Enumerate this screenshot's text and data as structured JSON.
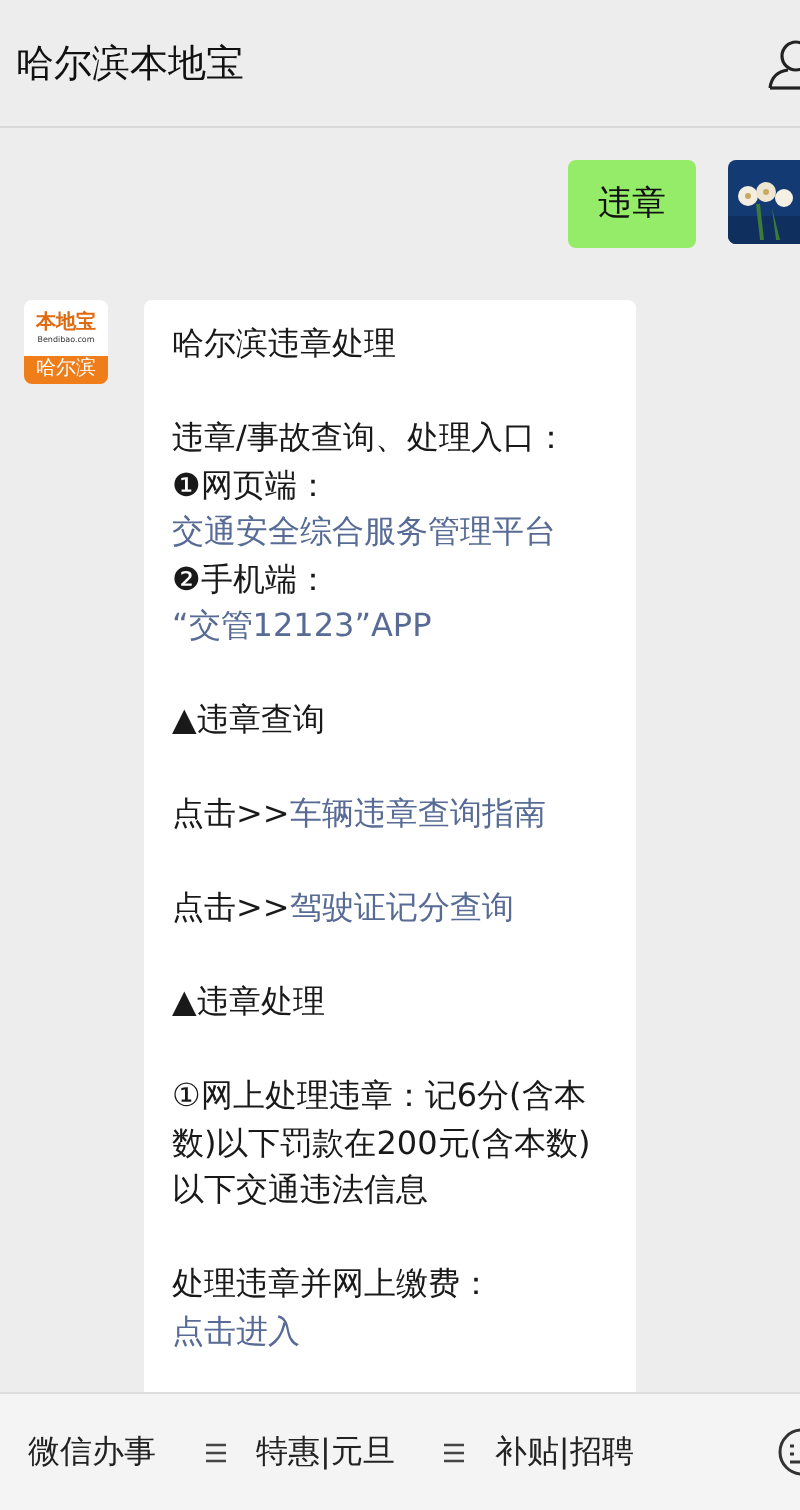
{
  "header": {
    "title": "哈尔滨本地宝"
  },
  "sent": {
    "text": "违章"
  },
  "received": {
    "logo": {
      "brand": "本地宝",
      "domain": "Bendibao.com",
      "city": "哈尔滨"
    },
    "paragraphs": [
      {
        "lines": [
          {
            "kind": "text",
            "text": "哈尔滨违章处理"
          }
        ]
      },
      {
        "lines": [
          {
            "kind": "text",
            "text": "违章/事故查询、处理入口："
          },
          {
            "kind": "text",
            "text": "❶网页端："
          },
          {
            "kind": "link",
            "text": "交通安全综合服务管理平台"
          },
          {
            "kind": "text",
            "text": "❷手机端："
          },
          {
            "kind": "link",
            "text": "“交管12123”APP"
          }
        ]
      },
      {
        "lines": [
          {
            "kind": "text",
            "text": "▲违章查询"
          }
        ]
      },
      {
        "lines": [
          {
            "kind": "mixed",
            "text": "点击>>",
            "link": "车辆违章查询指南"
          }
        ]
      },
      {
        "lines": [
          {
            "kind": "mixed",
            "text": "点击>>",
            "link": "驾驶证记分查询"
          }
        ]
      },
      {
        "lines": [
          {
            "kind": "text",
            "text": "▲违章处理"
          }
        ]
      },
      {
        "lines": [
          {
            "kind": "text",
            "text": "①网上处理违章：记6分(含本数)以下罚款在200元(含本数)以下交通违法信息"
          }
        ]
      },
      {
        "lines": [
          {
            "kind": "text",
            "text": "处理违章并网上缴费："
          },
          {
            "kind": "link",
            "text": "点击进入"
          }
        ]
      }
    ]
  },
  "menu": [
    {
      "label": "微信办事",
      "submenu": false
    },
    {
      "label": "特惠|元旦",
      "submenu": true
    },
    {
      "label": "补贴|招聘",
      "submenu": true
    }
  ]
}
